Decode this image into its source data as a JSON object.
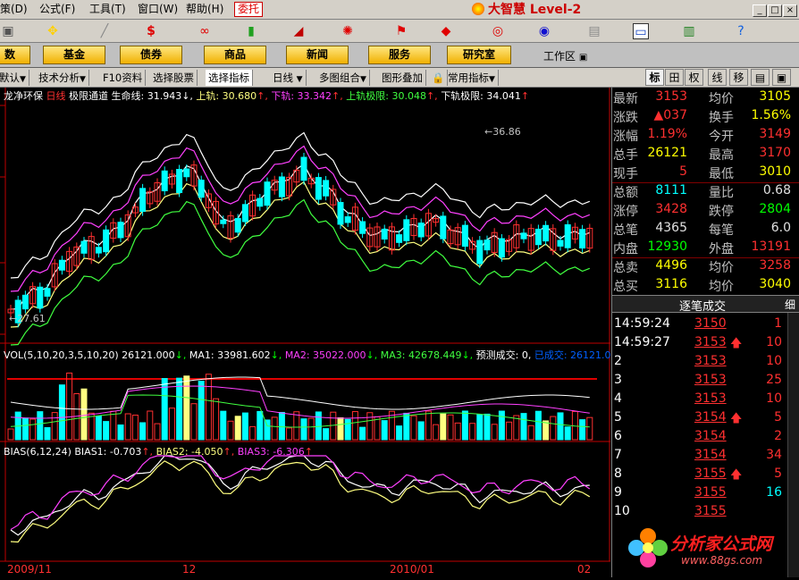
{
  "menu": [
    "策(D)",
    "公式(F)",
    "工具(T)",
    "窗口(W)",
    "帮助(H)"
  ],
  "weituo": "委托",
  "brand": "大智慧 Level-2",
  "nav": [
    "数",
    "基金",
    "债券",
    "商品",
    "新闻",
    "服务",
    "研究室"
  ],
  "workarea": "工作区",
  "tabs": {
    "default": "默认",
    "tech": "技术分析",
    "f10": "F10资料",
    "pick": "选择股票",
    "indicator": "选择指标",
    "period": "日线",
    "multi": "多图组合",
    "overlay": "图形叠加",
    "common": "常用指标"
  },
  "right_tabs": [
    "标",
    "田",
    "权",
    "线",
    "移"
  ],
  "indicator_line": {
    "name": "龙净环保",
    "period": "日线",
    "indicator": "极限通道",
    "life": "生命线: 31.943",
    "upper": "上轨: 30.680",
    "lower": "下轨: 33.342",
    "upper_limit": "上轨极限: 30.048",
    "lower_limit": "下轨极限: 34.041"
  },
  "price_labels": {
    "high": "36.86",
    "low": "27.61"
  },
  "vol_line": {
    "title": "VOL(5,10,20,3,5,10,20)",
    "value": "26121.000",
    "ma1": "MA1: 33981.602",
    "ma2": "MA2: 35022.000",
    "ma3": "MA3: 42678.449",
    "forecast": "预测成交: 0,",
    "done": "已成交: 26121.00"
  },
  "bias_line": {
    "title": "BIAS(6,12,24)",
    "bias1": "BIAS1: -0.703",
    "bias2": "BIAS2: -4.050",
    "bias3": "BIAS3: -6.306"
  },
  "xaxis": [
    "2009/11",
    "12",
    "2010/01",
    "02"
  ],
  "quote": [
    {
      "l1": "最新",
      "v1": "3153",
      "c1": "#ff3030",
      "l2": "均价",
      "v2": "3105",
      "c2": "#ffff00"
    },
    {
      "l1": "涨跌",
      "v1": "▲037",
      "c1": "#ff3030",
      "l2": "换手",
      "v2": "1.56%",
      "c2": "#ffff00"
    },
    {
      "l1": "涨幅",
      "v1": "1.19%",
      "c1": "#ff3030",
      "l2": "今开",
      "v2": "3149",
      "c2": "#ff3030"
    },
    {
      "l1": "总手",
      "v1": "26121",
      "c1": "#ffff00",
      "l2": "最高",
      "v2": "3170",
      "c2": "#ff3030"
    },
    {
      "l1": "现手",
      "v1": "5",
      "c1": "#ff3030",
      "l2": "最低",
      "v2": "3010",
      "c2": "#ffff00"
    },
    {
      "l1": "总额",
      "v1": "8111",
      "c1": "#00ffff",
      "l2": "量比",
      "v2": "0.68",
      "c2": "#e0e0e0"
    },
    {
      "l1": "涨停",
      "v1": "3428",
      "c1": "#ff3030",
      "l2": "跌停",
      "v2": "2804",
      "c2": "#00ff00"
    },
    {
      "l1": "总笔",
      "v1": "4365",
      "c1": "#e0e0e0",
      "l2": "每笔",
      "v2": "6.0",
      "c2": "#e0e0e0"
    },
    {
      "l1": "内盘",
      "v1": "12930",
      "c1": "#00ff00",
      "l2": "外盘",
      "v2": "13191",
      "c2": "#ff3030"
    },
    {
      "l1": "总卖",
      "v1": "4496",
      "c1": "#ffff00",
      "l2": "均价",
      "v2": "3258",
      "c2": "#ff3030"
    },
    {
      "l1": "总买",
      "v1": "3116",
      "c1": "#ffff00",
      "l2": "均价",
      "v2": "3040",
      "c2": "#ffff00"
    }
  ],
  "ticks_title": "逐笔成交",
  "ticks_xi": "细",
  "ticks": [
    {
      "t": "14:59:24",
      "p": "3150",
      "up": false,
      "v": "1",
      "vc": "#ff3030"
    },
    {
      "t": "14:59:27",
      "p": "3153",
      "up": true,
      "v": "10",
      "vc": "#ff3030"
    },
    {
      "t": "2",
      "p": "3153",
      "up": false,
      "v": "10",
      "vc": "#ff3030"
    },
    {
      "t": "3",
      "p": "3153",
      "up": false,
      "v": "25",
      "vc": "#ff3030"
    },
    {
      "t": "4",
      "p": "3153",
      "up": false,
      "v": "10",
      "vc": "#ff3030"
    },
    {
      "t": "5",
      "p": "3154",
      "up": true,
      "v": "5",
      "vc": "#ff3030"
    },
    {
      "t": "6",
      "p": "3154",
      "up": false,
      "v": "2",
      "vc": "#ff3030"
    },
    {
      "t": "7",
      "p": "3154",
      "up": false,
      "v": "34",
      "vc": "#ff3030"
    },
    {
      "t": "8",
      "p": "3155",
      "up": true,
      "v": "5",
      "vc": "#ff3030"
    },
    {
      "t": "9",
      "p": "3155",
      "up": false,
      "v": "16",
      "vc": "#00ffff"
    },
    {
      "t": "10",
      "p": "3155",
      "up": false,
      "v": "",
      "vc": "#ff3030"
    }
  ],
  "watermark": {
    "text": "分析家公式网",
    "url": "www.88gs.com"
  },
  "colors": {
    "up": "#ff3030",
    "down": "#00ffff",
    "life": "#ffffff",
    "band1": "#ff40ff",
    "band2": "#ffff80",
    "band3": "#40ff40",
    "axis": "#c00000"
  }
}
